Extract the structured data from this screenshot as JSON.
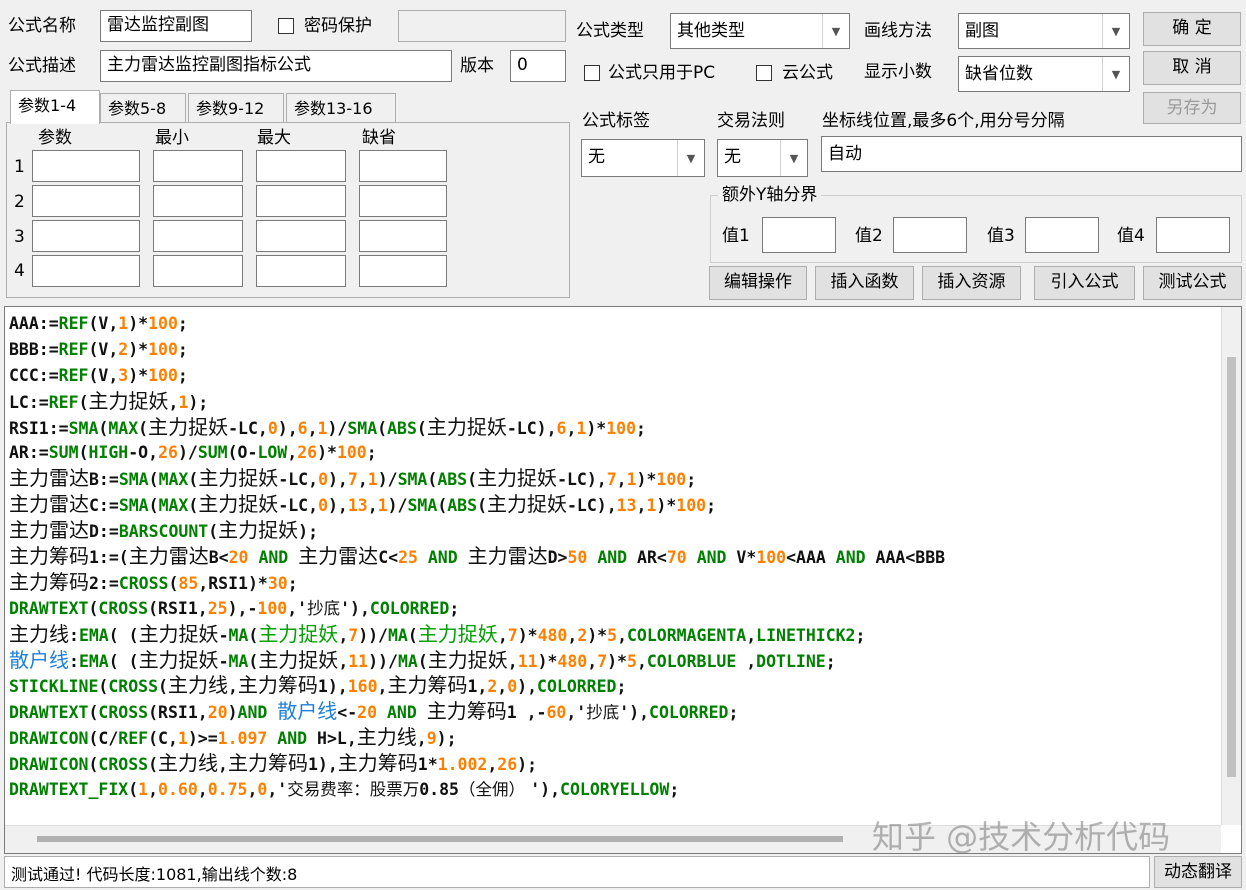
{
  "form": {
    "name_label": "公式名称",
    "name_value": "雷达监控副图",
    "password_label": "密码保护",
    "desc_label": "公式描述",
    "desc_value": "主力雷达监控副图指标公式",
    "version_label": "版本",
    "version_value": "0",
    "type_label": "公式类型",
    "type_value": "其他类型",
    "draw_label": "画线方法",
    "draw_value": "副图",
    "pc_only_label": "公式只用于PC",
    "cloud_label": "云公式",
    "decimals_label": "显示小数",
    "decimals_value": "缺省位数",
    "tag_label": "公式标签",
    "tag_value": "无",
    "rule_label": "交易法则",
    "rule_value": "无",
    "axis_label": "坐标线位置,最多6个,用分号分隔",
    "axis_value": "自动",
    "extra_y_label": "额外Y轴分界",
    "v1": "值1",
    "v2": "值2",
    "v3": "值3",
    "v4": "值4"
  },
  "buttons": {
    "ok": "确 定",
    "cancel": "取 消",
    "save_as": "另存为",
    "edit": "编辑操作",
    "insert_fn": "插入函数",
    "insert_res": "插入资源",
    "import": "引入公式",
    "test": "测试公式",
    "translate": "动态翻译"
  },
  "tabs": [
    "参数1-4",
    "参数5-8",
    "参数9-12",
    "参数13-16"
  ],
  "params": {
    "headers": [
      "参数",
      "最小",
      "最大",
      "缺省"
    ],
    "rows": [
      "1",
      "2",
      "3",
      "4"
    ]
  },
  "code": [
    [
      [
        "AAA:=",
        "d"
      ],
      [
        "REF",
        "f"
      ],
      [
        "(V,",
        "d"
      ],
      [
        "1",
        "n"
      ],
      [
        ")*",
        "d"
      ],
      [
        "100",
        "n"
      ],
      [
        ";",
        "d"
      ]
    ],
    [
      [
        "BBB:=",
        "d"
      ],
      [
        "REF",
        "f"
      ],
      [
        "(V,",
        "d"
      ],
      [
        "2",
        "n"
      ],
      [
        ")*",
        "d"
      ],
      [
        "100",
        "n"
      ],
      [
        ";",
        "d"
      ]
    ],
    [
      [
        "CCC:=",
        "d"
      ],
      [
        "REF",
        "f"
      ],
      [
        "(V,",
        "d"
      ],
      [
        "3",
        "n"
      ],
      [
        ")*",
        "d"
      ],
      [
        "100",
        "n"
      ],
      [
        ";",
        "d"
      ]
    ],
    [
      [
        "LC:=",
        "d"
      ],
      [
        "REF",
        "f"
      ],
      [
        "(",
        "d"
      ],
      [
        "主力捉妖",
        "c"
      ],
      [
        ",",
        "d"
      ],
      [
        "1",
        "n"
      ],
      [
        ");",
        "d"
      ]
    ],
    [
      [
        "RSI1:=",
        "d"
      ],
      [
        "SMA",
        "f"
      ],
      [
        "(",
        "d"
      ],
      [
        "MAX",
        "f"
      ],
      [
        "(",
        "d"
      ],
      [
        "主力捉妖",
        "c"
      ],
      [
        "-LC,",
        "d"
      ],
      [
        "0",
        "n"
      ],
      [
        "),",
        "d"
      ],
      [
        "6",
        "n"
      ],
      [
        ",",
        "d"
      ],
      [
        "1",
        "n"
      ],
      [
        ")/",
        "d"
      ],
      [
        "SMA",
        "f"
      ],
      [
        "(",
        "d"
      ],
      [
        "ABS",
        "f"
      ],
      [
        "(",
        "d"
      ],
      [
        "主力捉妖",
        "c"
      ],
      [
        "-LC),",
        "d"
      ],
      [
        "6",
        "n"
      ],
      [
        ",",
        "d"
      ],
      [
        "1",
        "n"
      ],
      [
        ")*",
        "d"
      ],
      [
        "100",
        "n"
      ],
      [
        ";",
        "d"
      ]
    ],
    [
      [
        "AR:=",
        "d"
      ],
      [
        "SUM",
        "f"
      ],
      [
        "(",
        "d"
      ],
      [
        "HIGH",
        "f"
      ],
      [
        "-O,",
        "d"
      ],
      [
        "26",
        "n"
      ],
      [
        ")/",
        "d"
      ],
      [
        "SUM",
        "f"
      ],
      [
        "(O-",
        "d"
      ],
      [
        "LOW",
        "f"
      ],
      [
        ",",
        "d"
      ],
      [
        "26",
        "n"
      ],
      [
        ")*",
        "d"
      ],
      [
        "100",
        "n"
      ],
      [
        ";",
        "d"
      ]
    ],
    [
      [
        "主力雷达",
        "c"
      ],
      [
        "B:=",
        "d"
      ],
      [
        "SMA",
        "f"
      ],
      [
        "(",
        "d"
      ],
      [
        "MAX",
        "f"
      ],
      [
        "(",
        "d"
      ],
      [
        "主力捉妖",
        "c"
      ],
      [
        "-LC,",
        "d"
      ],
      [
        "0",
        "n"
      ],
      [
        "),",
        "d"
      ],
      [
        "7",
        "n"
      ],
      [
        ",",
        "d"
      ],
      [
        "1",
        "n"
      ],
      [
        ")/",
        "d"
      ],
      [
        "SMA",
        "f"
      ],
      [
        "(",
        "d"
      ],
      [
        "ABS",
        "f"
      ],
      [
        "(",
        "d"
      ],
      [
        "主力捉妖",
        "c"
      ],
      [
        "-LC),",
        "d"
      ],
      [
        "7",
        "n"
      ],
      [
        ",",
        "d"
      ],
      [
        "1",
        "n"
      ],
      [
        ")*",
        "d"
      ],
      [
        "100",
        "n"
      ],
      [
        ";",
        "d"
      ]
    ],
    [
      [
        "主力雷达",
        "c"
      ],
      [
        "C:=",
        "d"
      ],
      [
        "SMA",
        "f"
      ],
      [
        "(",
        "d"
      ],
      [
        "MAX",
        "f"
      ],
      [
        "(",
        "d"
      ],
      [
        "主力捉妖",
        "c"
      ],
      [
        "-LC,",
        "d"
      ],
      [
        "0",
        "n"
      ],
      [
        "),",
        "d"
      ],
      [
        "13",
        "n"
      ],
      [
        ",",
        "d"
      ],
      [
        "1",
        "n"
      ],
      [
        ")/",
        "d"
      ],
      [
        "SMA",
        "f"
      ],
      [
        "(",
        "d"
      ],
      [
        "ABS",
        "f"
      ],
      [
        "(",
        "d"
      ],
      [
        "主力捉妖",
        "c"
      ],
      [
        "-LC),",
        "d"
      ],
      [
        "13",
        "n"
      ],
      [
        ",",
        "d"
      ],
      [
        "1",
        "n"
      ],
      [
        ")*",
        "d"
      ],
      [
        "100",
        "n"
      ],
      [
        ";",
        "d"
      ]
    ],
    [
      [
        "主力雷达",
        "c"
      ],
      [
        "D:=",
        "d"
      ],
      [
        "BARSCOUNT",
        "f"
      ],
      [
        "(",
        "d"
      ],
      [
        "主力捉妖",
        "c"
      ],
      [
        ");",
        "d"
      ]
    ],
    [
      [
        "主力筹码",
        "c"
      ],
      [
        "1:=(",
        "d"
      ],
      [
        "主力雷达",
        "c"
      ],
      [
        "B<",
        "d"
      ],
      [
        "20",
        "n"
      ],
      [
        " ",
        "d"
      ],
      [
        "AND",
        "f"
      ],
      [
        " ",
        "d"
      ],
      [
        "主力雷达",
        "c"
      ],
      [
        "C<",
        "d"
      ],
      [
        "25",
        "n"
      ],
      [
        " ",
        "d"
      ],
      [
        "AND",
        "f"
      ],
      [
        " ",
        "d"
      ],
      [
        "主力雷达",
        "c"
      ],
      [
        "D>",
        "d"
      ],
      [
        "50",
        "n"
      ],
      [
        " ",
        "d"
      ],
      [
        "AND",
        "f"
      ],
      [
        " AR<",
        "d"
      ],
      [
        "70",
        "n"
      ],
      [
        " ",
        "d"
      ],
      [
        "AND",
        "f"
      ],
      [
        " V*",
        "d"
      ],
      [
        "100",
        "n"
      ],
      [
        "<AAA ",
        "d"
      ],
      [
        "AND",
        "f"
      ],
      [
        " AAA<BBB",
        "d"
      ]
    ],
    [
      [
        "主力筹码",
        "c"
      ],
      [
        "2:=",
        "d"
      ],
      [
        "CROSS",
        "f"
      ],
      [
        "(",
        "d"
      ],
      [
        "85",
        "n"
      ],
      [
        ",RSI1)*",
        "d"
      ],
      [
        "30",
        "n"
      ],
      [
        ";",
        "d"
      ]
    ],
    [
      [
        "DRAWTEXT",
        "f"
      ],
      [
        "(",
        "d"
      ],
      [
        "CROSS",
        "f"
      ],
      [
        "(RSI1,",
        "d"
      ],
      [
        "25",
        "n"
      ],
      [
        "),-",
        "d"
      ],
      [
        "100",
        "n"
      ],
      [
        ",'",
        "d"
      ],
      [
        "抄底",
        "s"
      ],
      [
        "'),",
        "d"
      ],
      [
        "COLORRED",
        "f"
      ],
      [
        ";",
        "d"
      ]
    ],
    [
      [
        "主力线",
        "c"
      ],
      [
        ":",
        "d"
      ],
      [
        "EMA",
        "f"
      ],
      [
        "( (",
        "d"
      ],
      [
        "主力捉妖",
        "c"
      ],
      [
        "-",
        "d"
      ],
      [
        "MA",
        "f"
      ],
      [
        "(",
        "d"
      ],
      [
        "主力捉妖",
        "g"
      ],
      [
        ",",
        "d"
      ],
      [
        "7",
        "n"
      ],
      [
        "))/",
        "d"
      ],
      [
        "MA",
        "f"
      ],
      [
        "(",
        "d"
      ],
      [
        "主力捉妖",
        "g"
      ],
      [
        ",",
        "d"
      ],
      [
        "7",
        "n"
      ],
      [
        ")*",
        "d"
      ],
      [
        "480",
        "n"
      ],
      [
        ",",
        "d"
      ],
      [
        "2",
        "n"
      ],
      [
        ")*",
        "d"
      ],
      [
        "5",
        "n"
      ],
      [
        ",",
        "d"
      ],
      [
        "COLORMAGENTA",
        "f"
      ],
      [
        ",",
        "d"
      ],
      [
        "LINETHICK2",
        "f"
      ],
      [
        ";",
        "d"
      ]
    ],
    [
      [
        "散户线",
        "b"
      ],
      [
        ":",
        "d"
      ],
      [
        "EMA",
        "f"
      ],
      [
        "( (",
        "d"
      ],
      [
        "主力捉妖",
        "c"
      ],
      [
        "-",
        "d"
      ],
      [
        "MA",
        "f"
      ],
      [
        "(",
        "d"
      ],
      [
        "主力捉妖",
        "c"
      ],
      [
        ",",
        "d"
      ],
      [
        "11",
        "n"
      ],
      [
        "))/",
        "d"
      ],
      [
        "MA",
        "f"
      ],
      [
        "(",
        "d"
      ],
      [
        "主力捉妖",
        "c"
      ],
      [
        ",",
        "d"
      ],
      [
        "11",
        "n"
      ],
      [
        ")*",
        "d"
      ],
      [
        "480",
        "n"
      ],
      [
        ",",
        "d"
      ],
      [
        "7",
        "n"
      ],
      [
        ")*",
        "d"
      ],
      [
        "5",
        "n"
      ],
      [
        ",",
        "d"
      ],
      [
        "COLORBLUE",
        "f"
      ],
      [
        " ,",
        "d"
      ],
      [
        "DOTLINE",
        "f"
      ],
      [
        ";",
        "d"
      ]
    ],
    [
      [
        "STICKLINE",
        "f"
      ],
      [
        "(",
        "d"
      ],
      [
        "CROSS",
        "f"
      ],
      [
        "(",
        "d"
      ],
      [
        "主力线",
        "c"
      ],
      [
        ",",
        "d"
      ],
      [
        "主力筹码",
        "c"
      ],
      [
        "1),",
        "d"
      ],
      [
        "160",
        "n"
      ],
      [
        ",",
        "d"
      ],
      [
        "主力筹码",
        "c"
      ],
      [
        "1,",
        "d"
      ],
      [
        "2",
        "n"
      ],
      [
        ",",
        "d"
      ],
      [
        "0",
        "n"
      ],
      [
        "),",
        "d"
      ],
      [
        "COLORRED",
        "f"
      ],
      [
        ";",
        "d"
      ]
    ],
    [
      [
        "DRAWTEXT",
        "f"
      ],
      [
        "(",
        "d"
      ],
      [
        "CROSS",
        "f"
      ],
      [
        "(RSI1,",
        "d"
      ],
      [
        "20",
        "n"
      ],
      [
        ")",
        "d"
      ],
      [
        "AND",
        "f"
      ],
      [
        " ",
        "d"
      ],
      [
        "散户线",
        "b"
      ],
      [
        "<-",
        "d"
      ],
      [
        "20",
        "n"
      ],
      [
        " ",
        "d"
      ],
      [
        "AND",
        "f"
      ],
      [
        " ",
        "d"
      ],
      [
        "主力筹码",
        "c"
      ],
      [
        "1 ,-",
        "d"
      ],
      [
        "60",
        "n"
      ],
      [
        ",'",
        "d"
      ],
      [
        "抄底",
        "s"
      ],
      [
        "'),",
        "d"
      ],
      [
        "COLORRED",
        "f"
      ],
      [
        ";",
        "d"
      ]
    ],
    [
      [
        "DRAWICON",
        "f"
      ],
      [
        "(C/",
        "d"
      ],
      [
        "REF",
        "f"
      ],
      [
        "(C,",
        "d"
      ],
      [
        "1",
        "n"
      ],
      [
        ")>=",
        "d"
      ],
      [
        "1.097",
        "n"
      ],
      [
        " ",
        "d"
      ],
      [
        "AND",
        "f"
      ],
      [
        " H>L,",
        "d"
      ],
      [
        "主力线",
        "c"
      ],
      [
        ",",
        "d"
      ],
      [
        "9",
        "n"
      ],
      [
        ");",
        "d"
      ]
    ],
    [
      [
        "DRAWICON",
        "f"
      ],
      [
        "(",
        "d"
      ],
      [
        "CROSS",
        "f"
      ],
      [
        "(",
        "d"
      ],
      [
        "主力线",
        "c"
      ],
      [
        ",",
        "d"
      ],
      [
        "主力筹码",
        "c"
      ],
      [
        "1),",
        "d"
      ],
      [
        "主力筹码",
        "c"
      ],
      [
        "1*",
        "d"
      ],
      [
        "1.002",
        "n"
      ],
      [
        ",",
        "d"
      ],
      [
        "26",
        "n"
      ],
      [
        ");",
        "d"
      ]
    ],
    [
      [
        "DRAWTEXT_FIX",
        "f"
      ],
      [
        "(",
        "d"
      ],
      [
        "1",
        "n"
      ],
      [
        ",",
        "d"
      ],
      [
        "0.60",
        "n"
      ],
      [
        ",",
        "d"
      ],
      [
        "0.75",
        "n"
      ],
      [
        ",",
        "d"
      ],
      [
        "0",
        "n"
      ],
      [
        ",'",
        "d"
      ],
      [
        "交易费率：股票万",
        "s"
      ],
      [
        "0.85",
        "d"
      ],
      [
        "（全佣） ",
        "s"
      ],
      [
        "'),",
        "d"
      ],
      [
        "COLORYELLOW",
        "f"
      ],
      [
        ";",
        "d"
      ]
    ]
  ],
  "status": "测试通过! 代码长度:1081,输出线个数:8",
  "watermark": "知乎 @技术分析代码"
}
